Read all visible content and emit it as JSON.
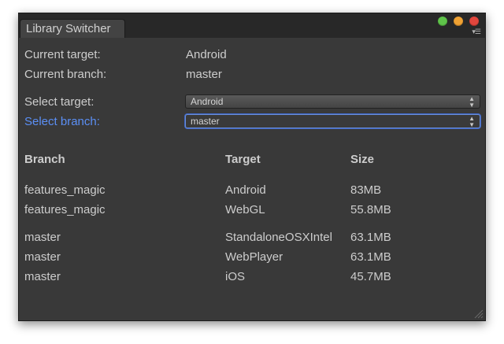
{
  "window": {
    "title": "Library Switcher",
    "traffic_lights": {
      "green": "#5fc44a",
      "yellow": "#f0a233",
      "red": "#e2463d"
    },
    "menu_icon": "menu-icon"
  },
  "info": {
    "current_target_label": "Current target:",
    "current_target_value": "Android",
    "current_branch_label": "Current branch:",
    "current_branch_value": "master"
  },
  "form": {
    "select_target_label": "Select target:",
    "select_target_value": "Android",
    "select_branch_label": "Select branch:",
    "select_branch_value": "master",
    "accent": "#5b8ff5"
  },
  "table": {
    "headers": {
      "branch": "Branch",
      "target": "Target",
      "size": "Size"
    },
    "rows": [
      {
        "branch": "features_magic",
        "target": "Android",
        "size": "83MB"
      },
      {
        "branch": "features_magic",
        "target": "WebGL",
        "size": "55.8MB"
      },
      {
        "branch": "master",
        "target": "StandaloneOSXIntel",
        "size": "63.1MB"
      },
      {
        "branch": "master",
        "target": "WebPlayer",
        "size": "63.1MB"
      },
      {
        "branch": "master",
        "target": "iOS",
        "size": "45.7MB"
      }
    ]
  }
}
